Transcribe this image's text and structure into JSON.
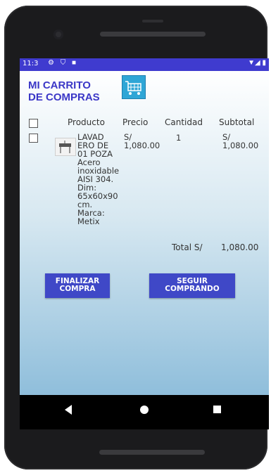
{
  "status": {
    "time": "11:3",
    "left_icons": "⚙ ⛉ ■",
    "right_icons": "▼◢ ▮"
  },
  "header": {
    "title_line1": "MI CARRITO",
    "title_line2": "DE COMPRAS"
  },
  "table": {
    "columns": [
      "Producto",
      "Precio",
      "Cantidad",
      "Subtotal"
    ],
    "row": {
      "description_lines": [
        "LAVAD",
        "ERO DE",
        "01 POZA",
        "Acero",
        "inoxidable",
        "AISI 304.",
        "Dim:",
        "65x60x90",
        "cm.",
        "Marca:",
        "Metix"
      ],
      "price_lines": [
        "S/",
        "1,080.00"
      ],
      "quantity": "1",
      "subtotal_lines": [
        "S/",
        "1,080.00"
      ]
    }
  },
  "total": {
    "label": "Total S/",
    "value": "1,080.00"
  },
  "buttons": {
    "finalize_line1": "FINALIZAR",
    "finalize_line2": "COMPRA",
    "continue_line1": "SEGUIR",
    "continue_line2": "COMPRANDO"
  },
  "icons": {
    "cart": "shopping-cart-icon",
    "thumb": "sink-product-icon"
  },
  "colors": {
    "accent": "#3f48c7",
    "title": "#3b37c7",
    "statusbar": "#3f3bcf"
  }
}
